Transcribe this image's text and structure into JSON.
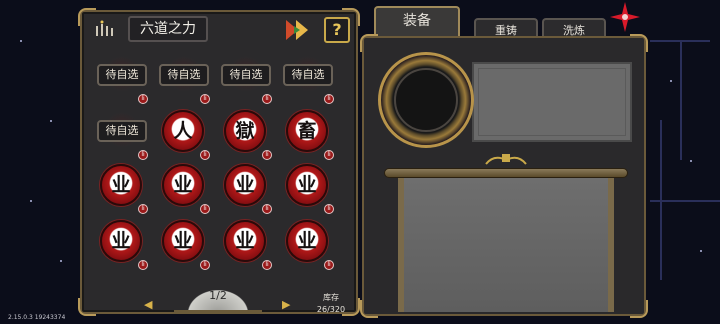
{
  "left_panel": {
    "title": "六道之力",
    "help_label": "?"
  },
  "slots": {
    "empty_label": "待自选",
    "filled_glyphs": [
      "人",
      "獄",
      "畜",
      "业",
      "业",
      "业",
      "业",
      "业",
      "业",
      "业",
      "业"
    ]
  },
  "pager": {
    "page_text": "1/2"
  },
  "stock": {
    "label": "库存",
    "value": "26/320"
  },
  "tabs": {
    "equip": "装备",
    "reforge": "重铸",
    "refine": "洗炼"
  },
  "version": "2.15.0.3 19243374",
  "colors": {
    "accent_gold": "#c9a94a",
    "disc_red": "#b01818",
    "panel_bg": "#2b2a2c"
  }
}
